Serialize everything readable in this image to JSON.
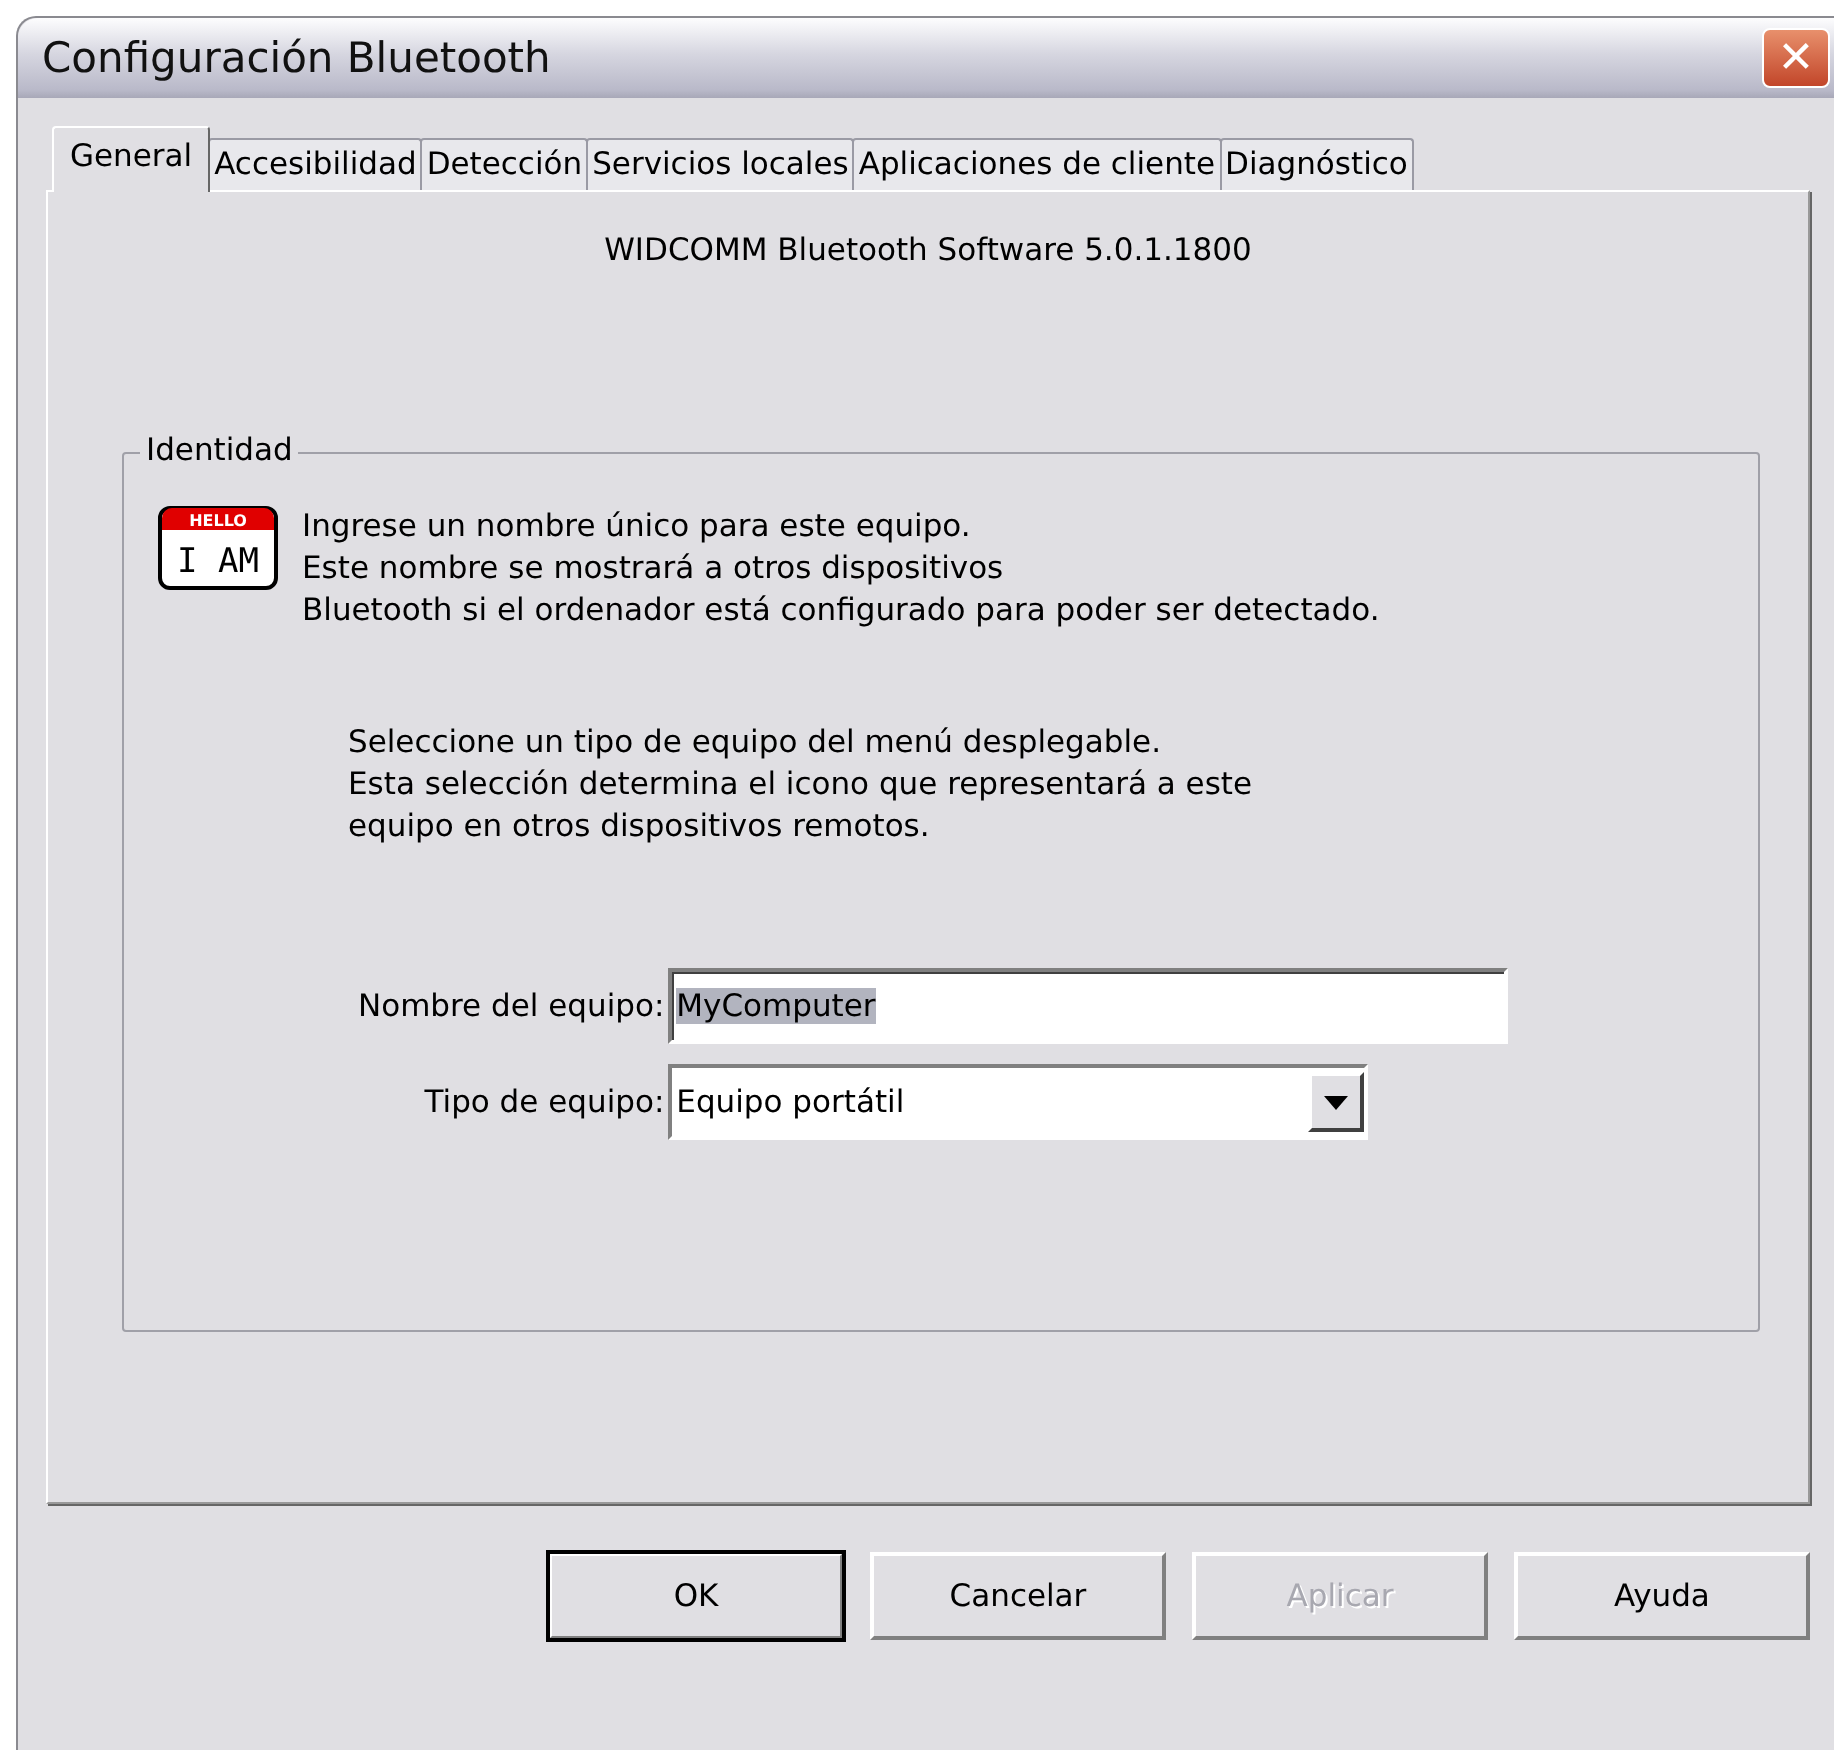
{
  "window": {
    "title": "Configuración Bluetooth",
    "close": "✕"
  },
  "tabs": [
    {
      "label": "General",
      "selected": true
    },
    {
      "label": "Accesibilidad",
      "selected": false
    },
    {
      "label": "Detección",
      "selected": false
    },
    {
      "label": "Servicios locales",
      "selected": false
    },
    {
      "label": "Aplicaciones de cliente",
      "selected": false
    },
    {
      "label": "Diagnóstico",
      "selected": false
    }
  ],
  "version": "WIDCOMM Bluetooth Software 5.0.1.1800",
  "identity": {
    "legend": "Identidad",
    "icon_top": "HELLO",
    "icon_text": "I AM",
    "intro": [
      "Ingrese un nombre único para este equipo.",
      "Este nombre se mostrará a otros dispositivos",
      "Bluetooth si el ordenador está configurado para poder ser detectado."
    ],
    "type_help": [
      "Seleccione un tipo de equipo del menú desplegable.",
      "Esta selección determina el icono que representará a este",
      "equipo en otros dispositivos remotos."
    ],
    "name_field": {
      "label": "Nombre del equipo:",
      "value": "MyComputer",
      "highlighted": true
    },
    "type_field": {
      "label": "Tipo de equipo:",
      "value": "Equipo portátil"
    }
  },
  "buttons": [
    {
      "label": "OK",
      "default": true,
      "disabled": false
    },
    {
      "label": "Cancelar",
      "default": false,
      "disabled": false
    },
    {
      "label": "Aplicar",
      "default": false,
      "disabled": true
    },
    {
      "label": "Ayuda",
      "default": false,
      "disabled": false
    }
  ]
}
